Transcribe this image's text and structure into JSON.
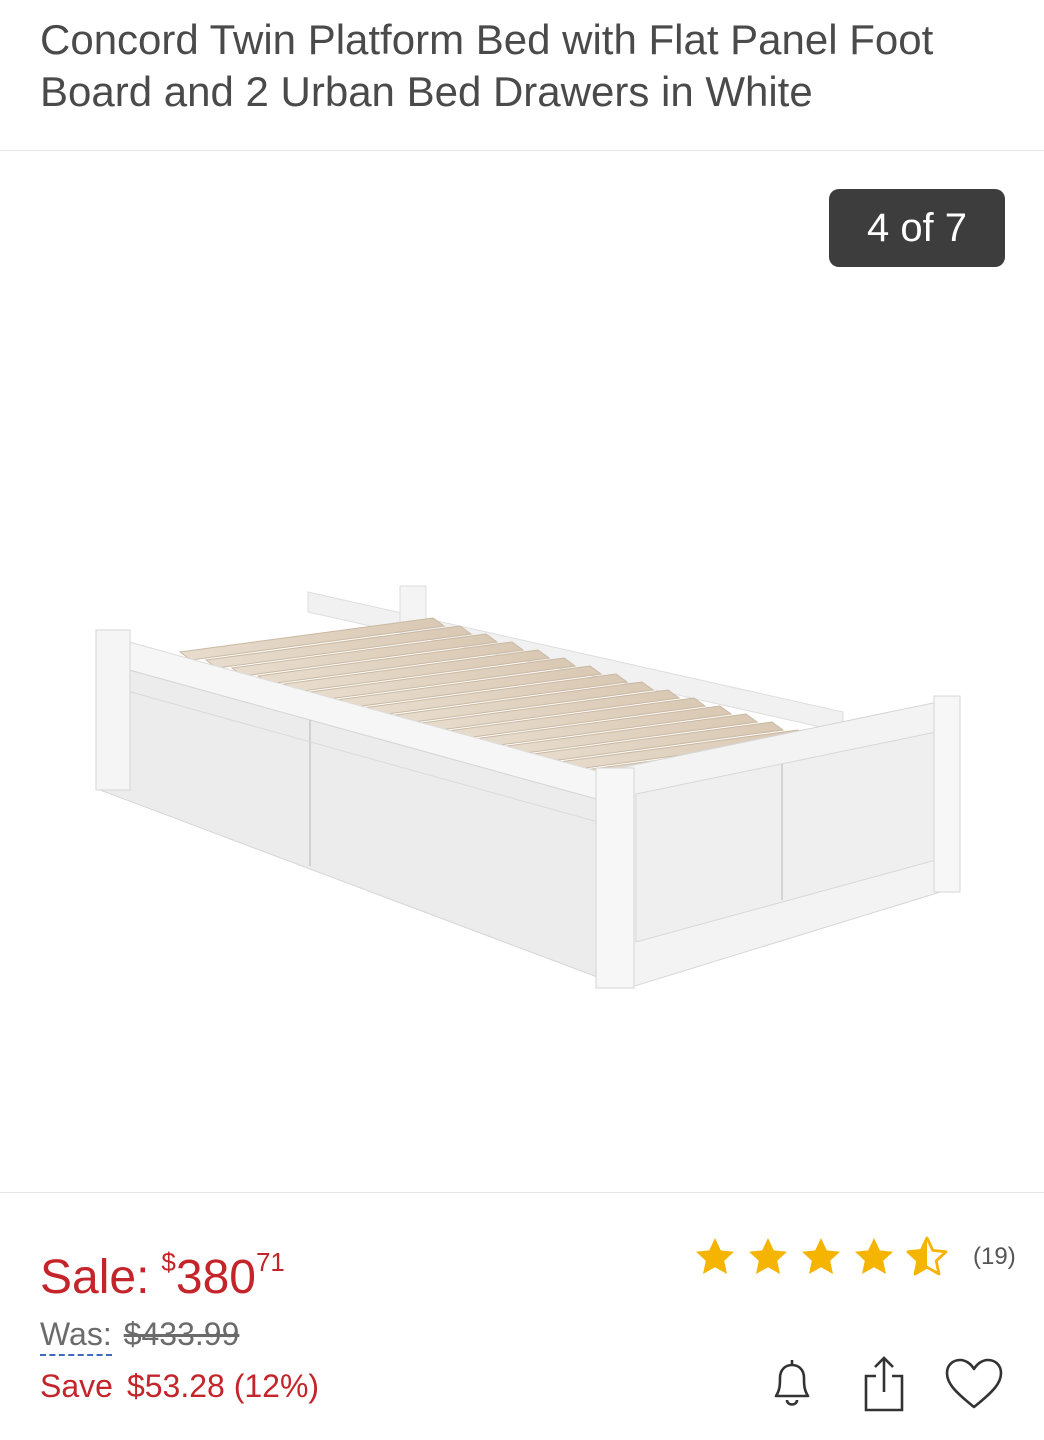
{
  "product": {
    "title": "Concord Twin Platform Bed with Flat Panel Foot Board and 2 Urban Bed Drawers in White"
  },
  "gallery": {
    "counter": "4 of 7",
    "current": 4,
    "total": 7
  },
  "pricing": {
    "sale_label": "Sale:",
    "currency_symbol": "$",
    "sale_dollars": "380",
    "sale_cents": "71",
    "was_label": "Was:",
    "was_price": "$433.99",
    "save_label": "Save",
    "save_amount": "$53.28 (12%)"
  },
  "rating": {
    "stars": 4.5,
    "max": 5,
    "count": "(19)",
    "star_color": "#f5b400"
  },
  "actions": {
    "icons": [
      "bell-icon",
      "share-icon",
      "heart-icon"
    ]
  },
  "colors": {
    "sale_red": "#c4252a",
    "counter_bg": "#3d3d3d",
    "link_blue": "#3e6ab8"
  }
}
